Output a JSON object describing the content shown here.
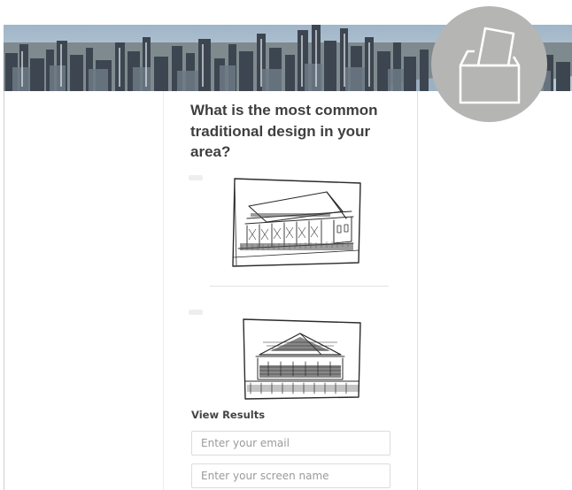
{
  "banner": {
    "image": "city-skyline-icon"
  },
  "vote_badge": {
    "icon": "ballot-box-icon",
    "color": "#b5b5b4"
  },
  "poll": {
    "question": "What is the most common traditional design in your area?",
    "options": [
      {
        "image": "queenslander-house-sketch-icon"
      },
      {
        "image": "pyramid-roof-cottage-sketch-icon"
      }
    ],
    "view_results_label": "View Results",
    "email_placeholder": "Enter your email",
    "screen_name_placeholder": "Enter your screen name"
  }
}
